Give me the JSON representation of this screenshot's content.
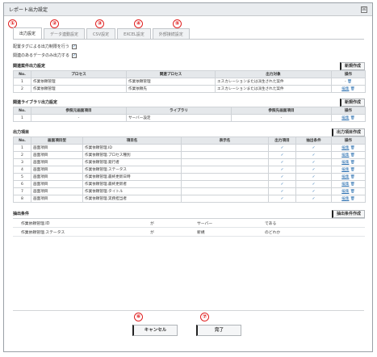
{
  "window": {
    "title": "レポート出力設定",
    "close_glyph": "☒"
  },
  "callouts": [
    "①",
    "②",
    "③",
    "④",
    "⑤",
    "⑥",
    "⑦"
  ],
  "tabs": [
    "出力設定",
    "データ連動設定",
    "CSV設定",
    "EXCEL設定",
    "外部接続設定"
  ],
  "options": [
    {
      "label": "配置タグによる出力制限を行う",
      "checked": true
    },
    {
      "label": "関連のあるデータのみ出力する",
      "checked": true
    }
  ],
  "related": {
    "title": "関連案件出力設定",
    "new_label": "新規作成",
    "headers": [
      "No.",
      "プロセス",
      "関連プロセス",
      "出力対象",
      "操作"
    ],
    "rows": [
      {
        "no": "1",
        "process": "作業依頼管理",
        "related": "作業依頼管理",
        "target": "エスカレーションまたは派生された案件",
        "op": "-"
      },
      {
        "no": "2",
        "process": "作業依頼管理",
        "related": "作業依頼先",
        "target": "エスカレーションまたは派生された案件",
        "op": "編集"
      }
    ]
  },
  "library": {
    "title": "関連ライブラリ出力設定",
    "new_label": "新規作成",
    "headers": [
      "No.",
      "参照元画面項目",
      "ライブラリ",
      "参照先画面項目",
      "操作"
    ],
    "rows": [
      {
        "no": "1",
        "source": "-",
        "library": "サーバー設定",
        "dest": "-",
        "op": "編集"
      }
    ]
  },
  "output": {
    "title": "出力項目",
    "new_label": "出力項目作成",
    "headers": [
      "No.",
      "画面項目型",
      "項目名",
      "表示名",
      "出力項目",
      "抽出条件",
      "操作"
    ],
    "rows": [
      {
        "no": "1",
        "type": "画面項目",
        "name": "作業依頼管理.ID"
      },
      {
        "no": "2",
        "type": "画面項目",
        "name": "作業依頼管理.プロセス種別"
      },
      {
        "no": "3",
        "type": "画面項目",
        "name": "作業依頼管理.発行者"
      },
      {
        "no": "4",
        "type": "画面項目",
        "name": "作業依頼管理.ステータス"
      },
      {
        "no": "5",
        "type": "画面項目",
        "name": "作業依頼管理.最終更新日時"
      },
      {
        "no": "6",
        "type": "画面項目",
        "name": "作業依頼管理.最終更新者"
      },
      {
        "no": "7",
        "type": "画面項目",
        "name": "作業依頼管理.タイトル"
      },
      {
        "no": "8",
        "type": "画面項目",
        "name": "作業依頼管理.実務担当者"
      }
    ],
    "edit_label": "編集",
    "check_glyph": "✓",
    "trash_glyph": "🗑"
  },
  "filter": {
    "title": "抽出条件",
    "new_label": "抽出条件作成",
    "rows": [
      {
        "field": "作業依頼管理.ID",
        "particle": "が",
        "value": "サーバー",
        "cond": "である"
      },
      {
        "field": "作業依頼管理.ステータス",
        "particle": "が",
        "value": "新規",
        "cond": "のどれか"
      }
    ]
  },
  "footer": {
    "cancel_label": "キャンセル",
    "ok_label": "完了"
  }
}
